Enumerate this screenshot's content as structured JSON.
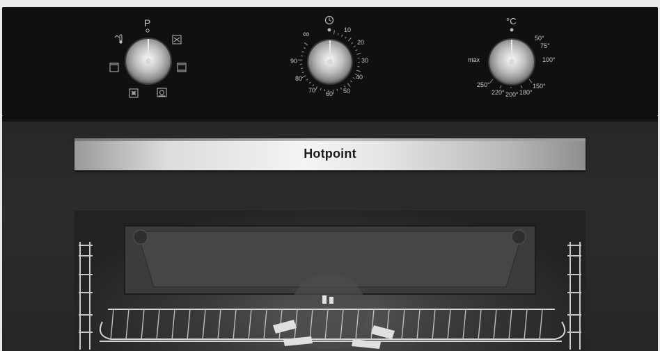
{
  "brand": "Hotpoint",
  "program_dial": {
    "top_label": "P",
    "icons": [
      "fan-thermometer-icon",
      "grill-icon",
      "top-heat-icon",
      "bottom-heat-icon",
      "defrost-icon",
      "fan-grill-icon"
    ]
  },
  "timer_dial": {
    "top_icon": "clock-icon",
    "infinity": "∞",
    "marks": [
      "10",
      "20",
      "30",
      "40",
      "50",
      "60",
      "70",
      "80",
      "90"
    ]
  },
  "temperature_dial": {
    "top_label": "°C",
    "marks": [
      "50°",
      "75°",
      "100°",
      "150°",
      "180°",
      "200°",
      "220°",
      "250°",
      "max"
    ]
  },
  "colors": {
    "panel": "#101010",
    "door": "#272727",
    "handle": "#e6e6e6",
    "text": "#c8c8c8"
  }
}
